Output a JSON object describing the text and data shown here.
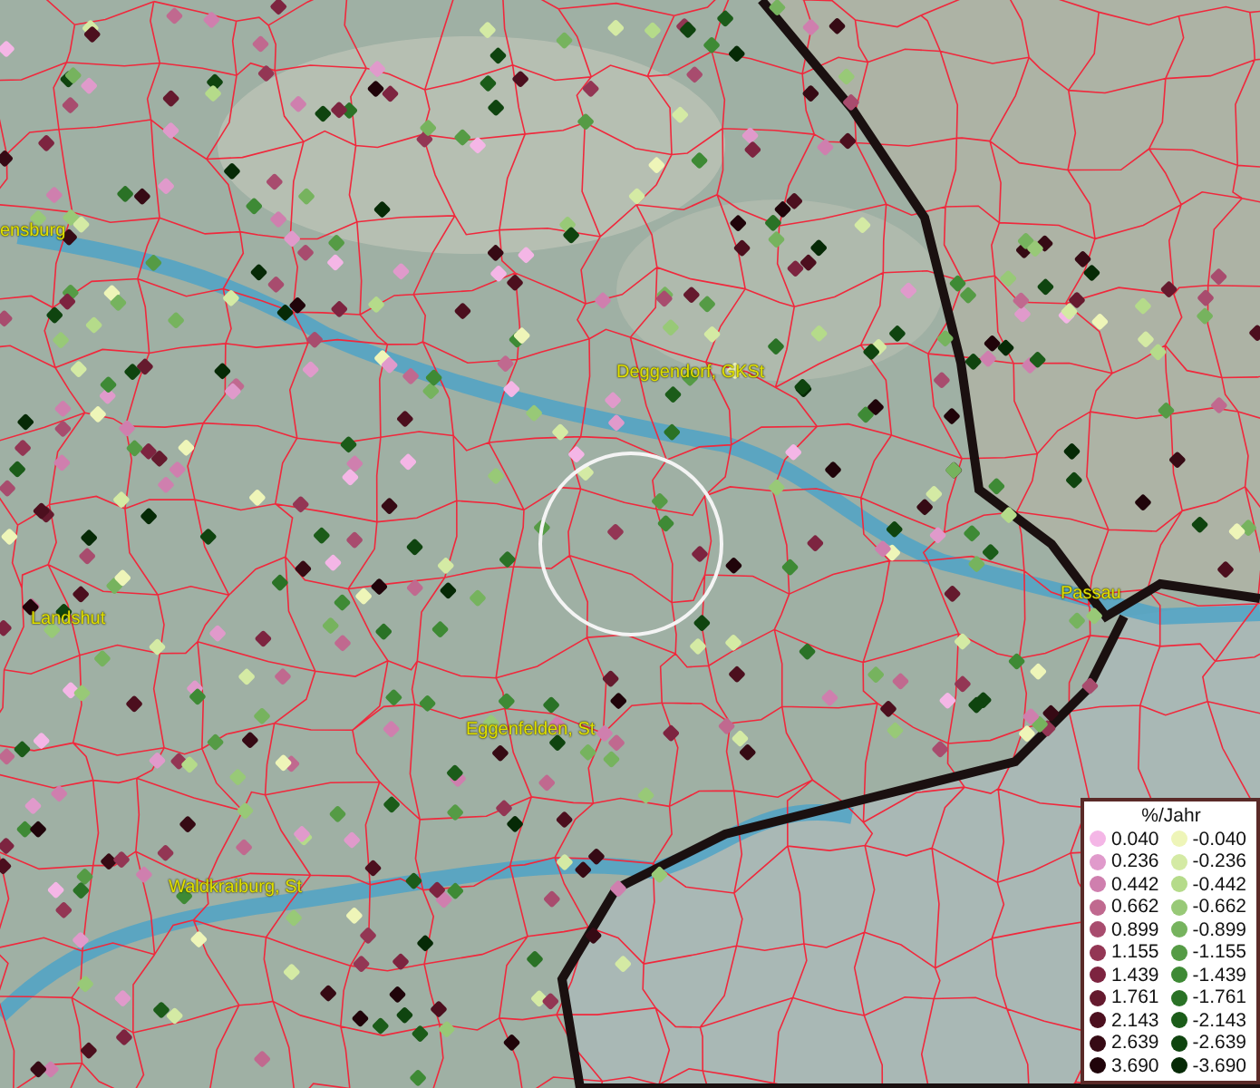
{
  "places": [
    {
      "name": "ensburg"
    },
    {
      "name": "Deggendorf, GKSt"
    },
    {
      "name": "Passau"
    },
    {
      "name": "Landshut"
    },
    {
      "name": "Eggenfelden, St"
    },
    {
      "name": "Waldkraiburg, St"
    }
  ],
  "legend": {
    "title": "%/Jahr",
    "rows": [
      {
        "positive": {
          "value": "0.040",
          "color": "#f4b6e6"
        },
        "negative": {
          "value": "-0.040",
          "color": "#eef5b8"
        }
      },
      {
        "positive": {
          "value": "0.236",
          "color": "#e09acb"
        },
        "negative": {
          "value": "-0.236",
          "color": "#d4eaa4"
        }
      },
      {
        "positive": {
          "value": "0.442",
          "color": "#cf7fae"
        },
        "negative": {
          "value": "-0.442",
          "color": "#b5db8a"
        }
      },
      {
        "positive": {
          "value": "0.662",
          "color": "#c0698f"
        },
        "negative": {
          "value": "-0.662",
          "color": "#98c977"
        }
      },
      {
        "positive": {
          "value": "0.899",
          "color": "#a84c6e"
        },
        "negative": {
          "value": "-0.899",
          "color": "#76b35e"
        }
      },
      {
        "positive": {
          "value": "1.155",
          "color": "#933654"
        },
        "negative": {
          "value": "-1.155",
          "color": "#559b45"
        }
      },
      {
        "positive": {
          "value": "1.439",
          "color": "#7d2440"
        },
        "negative": {
          "value": "-1.439",
          "color": "#3e8a35"
        }
      },
      {
        "positive": {
          "value": "1.761",
          "color": "#651a2e"
        },
        "negative": {
          "value": "-1.761",
          "color": "#2a7226"
        }
      },
      {
        "positive": {
          "value": "2.143",
          "color": "#4c0f1e"
        },
        "negative": {
          "value": "-2.143",
          "color": "#1b5c19"
        }
      },
      {
        "positive": {
          "value": "2.639",
          "color": "#360a14"
        },
        "negative": {
          "value": "-2.639",
          "color": "#0f440f"
        }
      },
      {
        "positive": {
          "value": "3.690",
          "color": "#20040a"
        },
        "negative": {
          "value": "-3.690",
          "color": "#062a06"
        }
      }
    ]
  }
}
